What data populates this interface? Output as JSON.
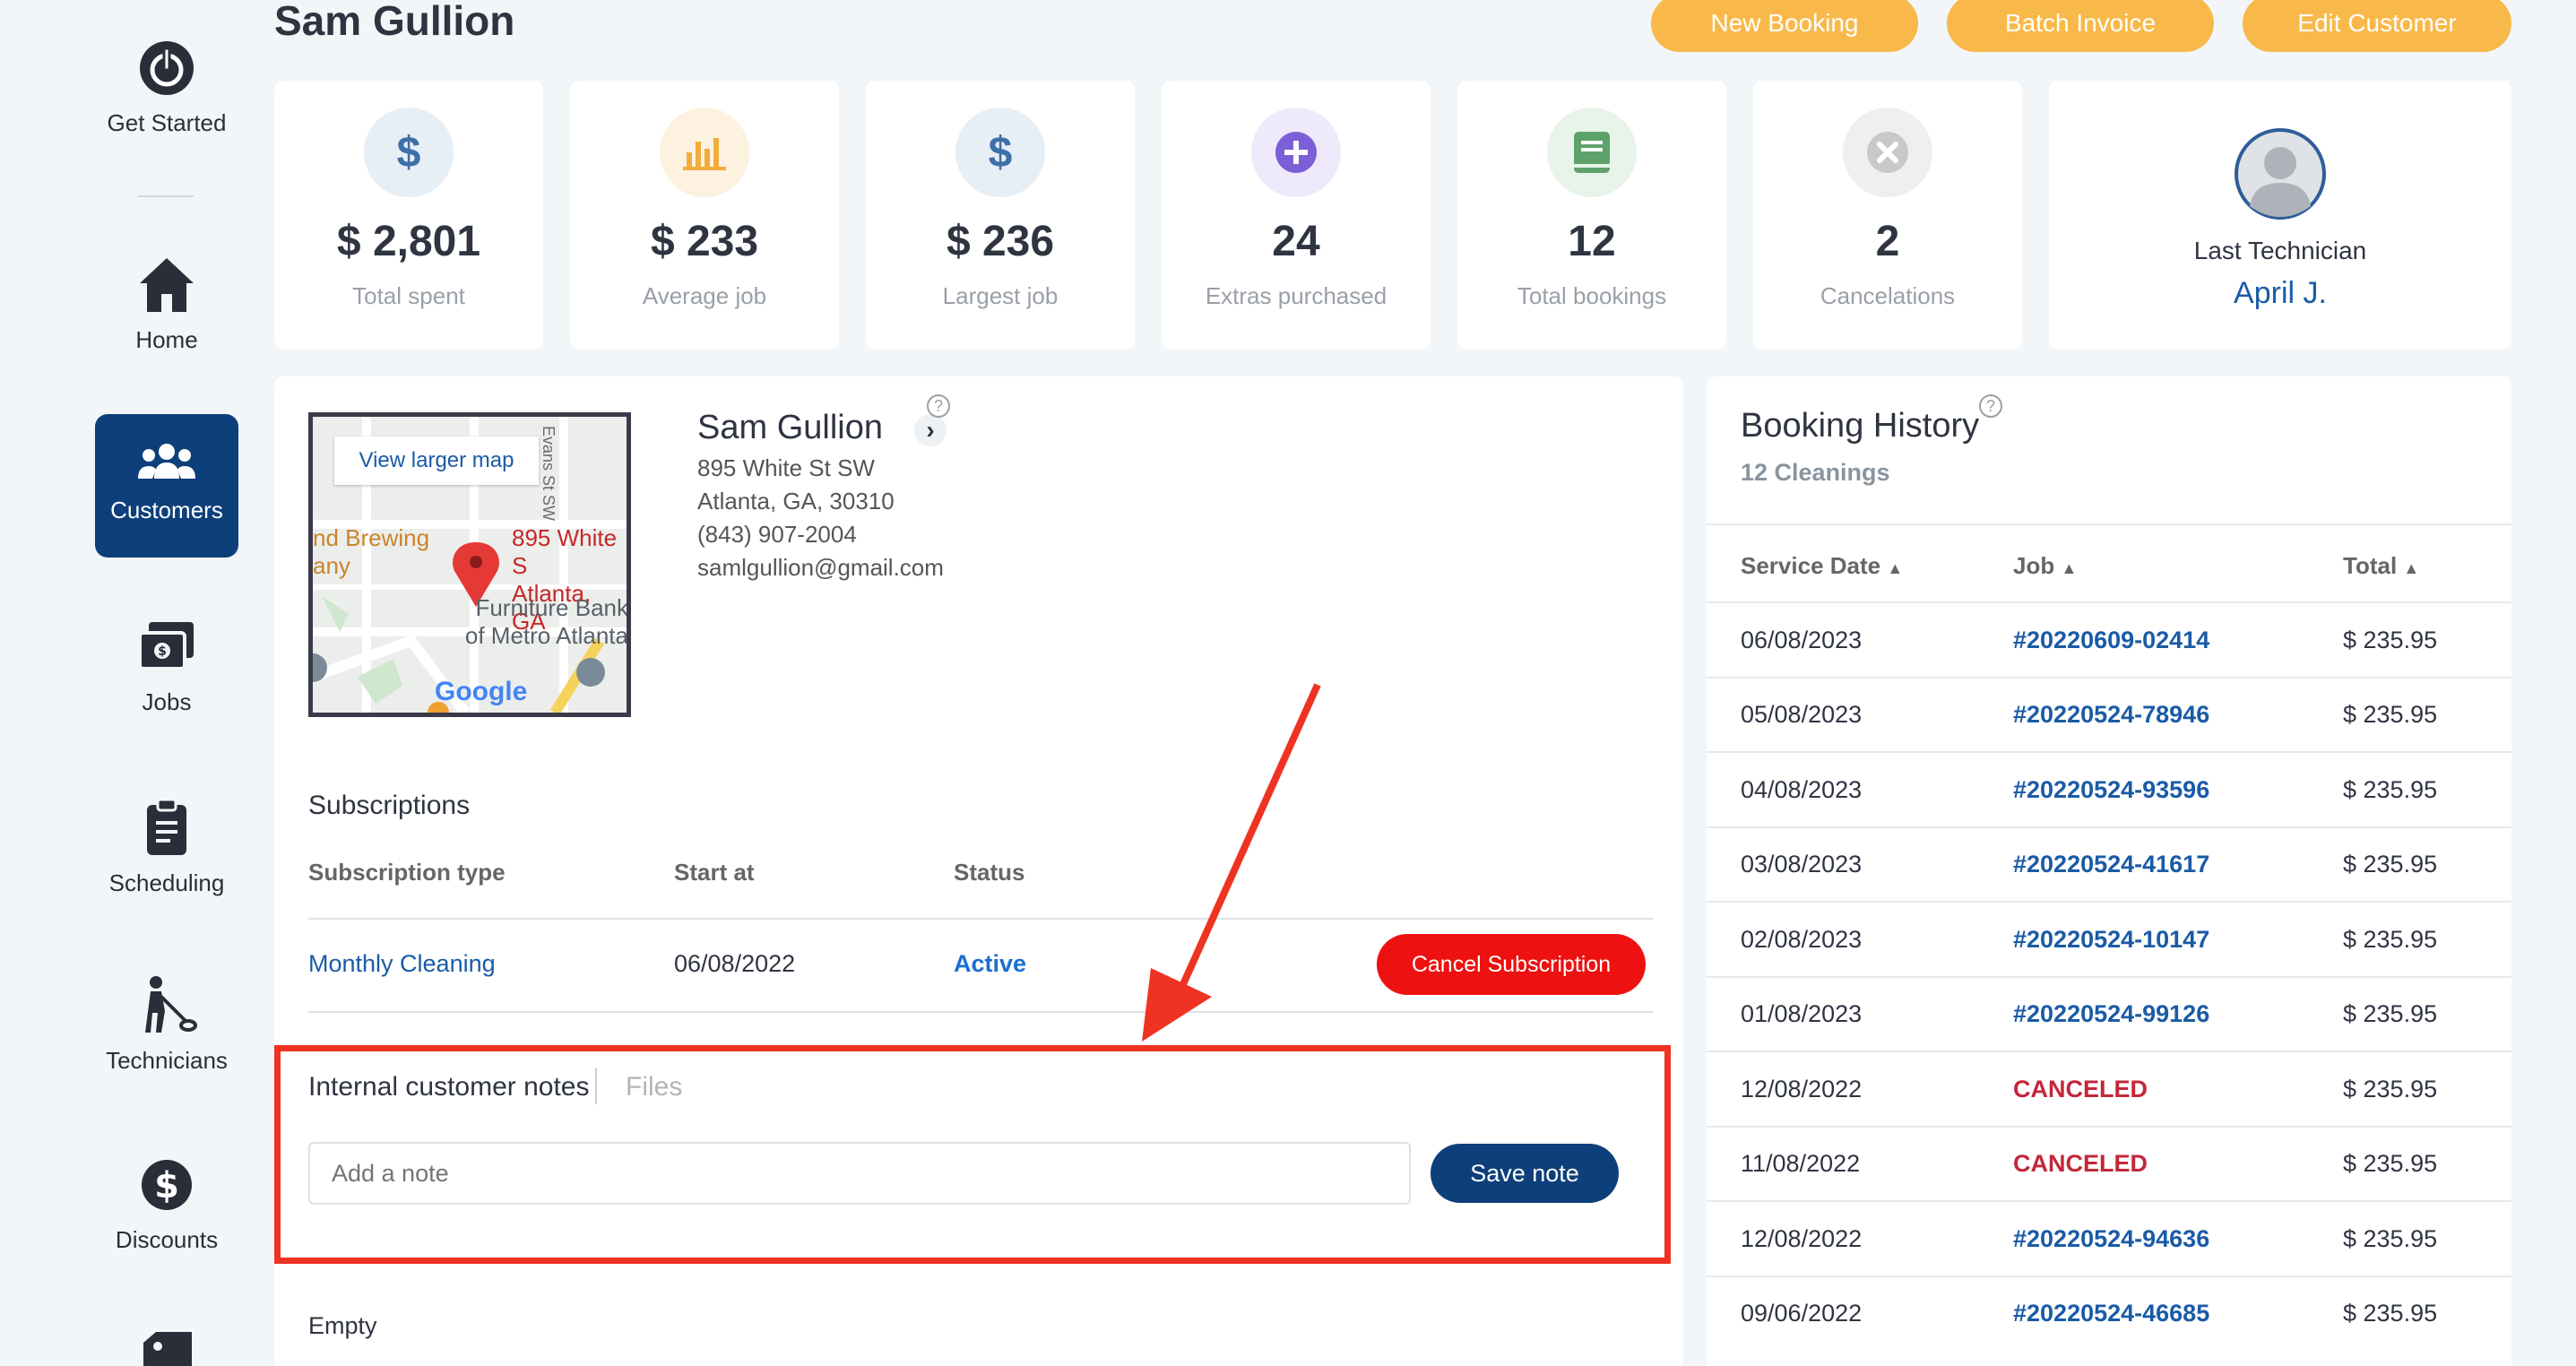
{
  "sidebar": {
    "items": [
      {
        "label": "Get Started",
        "icon": "power-icon"
      },
      {
        "label": "Home",
        "icon": "home-icon"
      },
      {
        "label": "Customers",
        "icon": "customers-icon"
      },
      {
        "label": "Jobs",
        "icon": "jobs-icon"
      },
      {
        "label": "Scheduling",
        "icon": "clipboard-icon"
      },
      {
        "label": "Technicians",
        "icon": "technician-icon"
      },
      {
        "label": "Discounts",
        "icon": "discount-icon"
      }
    ]
  },
  "header": {
    "title": "Sam Gullion",
    "new_booking": "New Booking",
    "batch_invoice": "Batch Invoice",
    "edit_customer": "Edit Customer"
  },
  "stats": [
    {
      "value": "$ 2,801",
      "label": "Total spent",
      "icon": "dollar-icon",
      "color": "#3d6fa8",
      "bg": "#e6eef6"
    },
    {
      "value": "$ 233",
      "label": "Average job",
      "icon": "bar-chart-icon",
      "color": "#f0ad3b",
      "bg": "#fdf1e0"
    },
    {
      "value": "$ 236",
      "label": "Largest job",
      "icon": "dollar-icon",
      "color": "#3d6fa8",
      "bg": "#e6eef6"
    },
    {
      "value": "24",
      "label": "Extras purchased",
      "icon": "plus-circle-icon",
      "color": "#7c5fd6",
      "bg": "#eeeafb"
    },
    {
      "value": "12",
      "label": "Total bookings",
      "icon": "book-icon",
      "color": "#5ea26a",
      "bg": "#e8f4ea"
    },
    {
      "value": "2",
      "label": "Cancelations",
      "icon": "x-circle-icon",
      "color": "#c8c8c8",
      "bg": "#efefef"
    }
  ],
  "last_technician": {
    "label": "Last Technician",
    "name": "April J."
  },
  "customer": {
    "name": "Sam Gullion",
    "address1": "895 White St SW",
    "address2": "Atlanta, GA, 30310",
    "phone": "(843) 907-2004",
    "email": "samlgullion@gmail.com"
  },
  "map": {
    "view_larger": "View larger map",
    "pin_label_1": "895 White S",
    "pin_label_2": "Atlanta, GA",
    "poi_1a": "nd Brewing",
    "poi_1b": "any",
    "poi_2a": "Furniture Bank",
    "poi_2b": "of Metro Atlanta",
    "street": "Evans St SW",
    "brand": "Google"
  },
  "subscriptions": {
    "title": "Subscriptions",
    "col_type": "Subscription type",
    "col_start": "Start at",
    "col_status": "Status",
    "row": {
      "type": "Monthly Cleaning",
      "start": "06/08/2022",
      "status": "Active",
      "cancel": "Cancel Subscription"
    }
  },
  "notes": {
    "tab_notes": "Internal customer notes",
    "tab_files": "Files",
    "placeholder": "Add a note",
    "save": "Save note",
    "empty": "Empty"
  },
  "history": {
    "title": "Booking History",
    "subtitle": "12 Cleanings",
    "col_date": "Service Date",
    "col_job": "Job",
    "col_total": "Total",
    "rows": [
      {
        "date": "06/08/2023",
        "job": "#20220609-02414",
        "total": "$ 235.95",
        "canceled": false
      },
      {
        "date": "05/08/2023",
        "job": "#20220524-78946",
        "total": "$ 235.95",
        "canceled": false
      },
      {
        "date": "04/08/2023",
        "job": "#20220524-93596",
        "total": "$ 235.95",
        "canceled": false
      },
      {
        "date": "03/08/2023",
        "job": "#20220524-41617",
        "total": "$ 235.95",
        "canceled": false
      },
      {
        "date": "02/08/2023",
        "job": "#20220524-10147",
        "total": "$ 235.95",
        "canceled": false
      },
      {
        "date": "01/08/2023",
        "job": "#20220524-99126",
        "total": "$ 235.95",
        "canceled": false
      },
      {
        "date": "12/08/2022",
        "job": "CANCELED",
        "total": "$ 235.95",
        "canceled": true
      },
      {
        "date": "11/08/2022",
        "job": "CANCELED",
        "total": "$ 235.95",
        "canceled": true
      },
      {
        "date": "12/08/2022",
        "job": "#20220524-94636",
        "total": "$ 235.95",
        "canceled": false
      },
      {
        "date": "09/06/2022",
        "job": "#20220524-46685",
        "total": "$ 235.95",
        "canceled": false
      }
    ]
  },
  "colors": {
    "accent": "#f9b94a",
    "primary": "#0d3f7a",
    "danger": "#ee1111",
    "annotation": "#ee3322"
  }
}
